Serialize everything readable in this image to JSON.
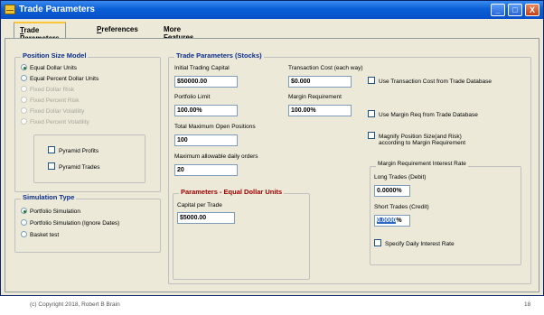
{
  "window": {
    "title": "Trade Parameters",
    "controls": {
      "minimize": "_",
      "maximize": "□",
      "close": "X"
    }
  },
  "tabs": [
    {
      "label_first": "T",
      "label_rest": "rade Parameters"
    },
    {
      "label_first": "P",
      "label_rest": "references"
    },
    {
      "label_first": "",
      "label_rest": "More Features...."
    }
  ],
  "position_size_model": {
    "title": "Position Size Model",
    "options": [
      "Equal Dollar Units",
      "Equal Percent Dollar Units",
      "Fixed Dollar Risk",
      "Fixed Percent Risk",
      "Fixed Dollar Volatility",
      "Fixed Percent Volatility"
    ],
    "pyramid_profits": "Pyramid Profits",
    "pyramid_trades": "Pyramid Trades"
  },
  "simulation_type": {
    "title": "Simulation Type",
    "options": [
      "Portfolio Simulation",
      "Portfolio Simulation (Ignore Dates)",
      "Basket test"
    ]
  },
  "trade_params": {
    "title": "Trade Parameters (Stocks)",
    "initial_capital_label": "Initial Trading Capital",
    "initial_capital_value": "$50000.00",
    "portfolio_limit_label": "Portfolio Limit",
    "portfolio_limit_value": "100.00%",
    "max_positions_label": "Total Maximum Open Positions",
    "max_positions_value": "100",
    "max_daily_orders_label": "Maximum allowable daily orders",
    "max_daily_orders_value": "20",
    "transaction_cost_label": "Transaction Cost (each way)",
    "transaction_cost_value": "$0.000",
    "margin_req_label": "Margin Requirement",
    "margin_req_value": "100.00%",
    "use_tx_cost_db": "Use Transaction Cost from Trade Database",
    "use_margin_db": "Use Margin Req from Trade Database",
    "magnify_line1": "Magnify Position Size(and Risk)",
    "magnify_line2": "according to Margin Requirement"
  },
  "equal_dollar_units": {
    "title": "Parameters - Equal Dollar Units",
    "capital_label": "Capital per Trade",
    "capital_value": "$5000.00"
  },
  "margin_interest": {
    "title": "Margin Requirement Interest Rate",
    "long_label": "Long Trades (Debit)",
    "long_value": "0.0000%",
    "short_label": "Short Trades (Credit)",
    "short_value_selected": "0.0000",
    "short_value_rest": "%",
    "daily_rate": "Specify Daily Interest Rate"
  },
  "footer": {
    "copyright": "(c) Copyright 2018, Robert B Brain",
    "page": "18"
  }
}
